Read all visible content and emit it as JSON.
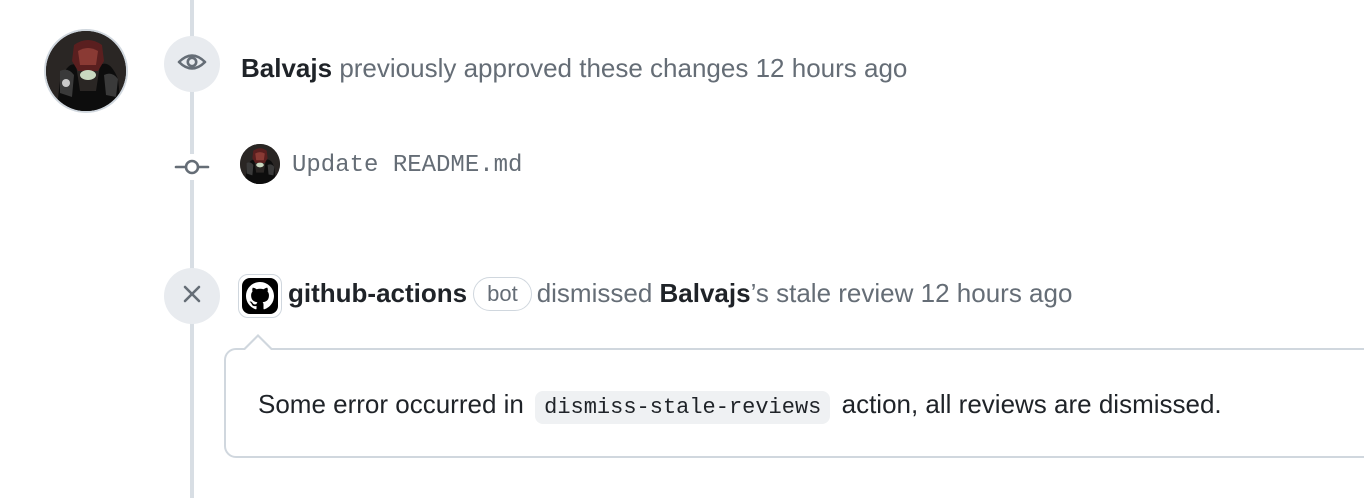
{
  "timeline": {
    "approved_event": {
      "author": "Balvajs",
      "text": "previously approved these changes",
      "time": "12 hours ago",
      "icon": "eye-icon"
    },
    "commit": {
      "message": "Update README.md",
      "icon": "git-commit-icon"
    },
    "dismissed_event": {
      "actor": "github-actions",
      "badge": "bot",
      "action": "dismissed",
      "target_user": "Balvajs",
      "suffix": "’s stale review",
      "time": "12 hours ago",
      "icon": "x-icon"
    },
    "comment": {
      "text_before": "Some error occurred in",
      "code": "dismiss-stale-reviews",
      "text_after": "action, all reviews are dismissed."
    }
  },
  "colors": {
    "timeline_line": "#d8dee4",
    "badge_bg": "#e8ebef",
    "muted_text": "#656d76",
    "primary_text": "#1f2328",
    "border": "#d0d7de",
    "code_bg": "#eff1f3"
  }
}
